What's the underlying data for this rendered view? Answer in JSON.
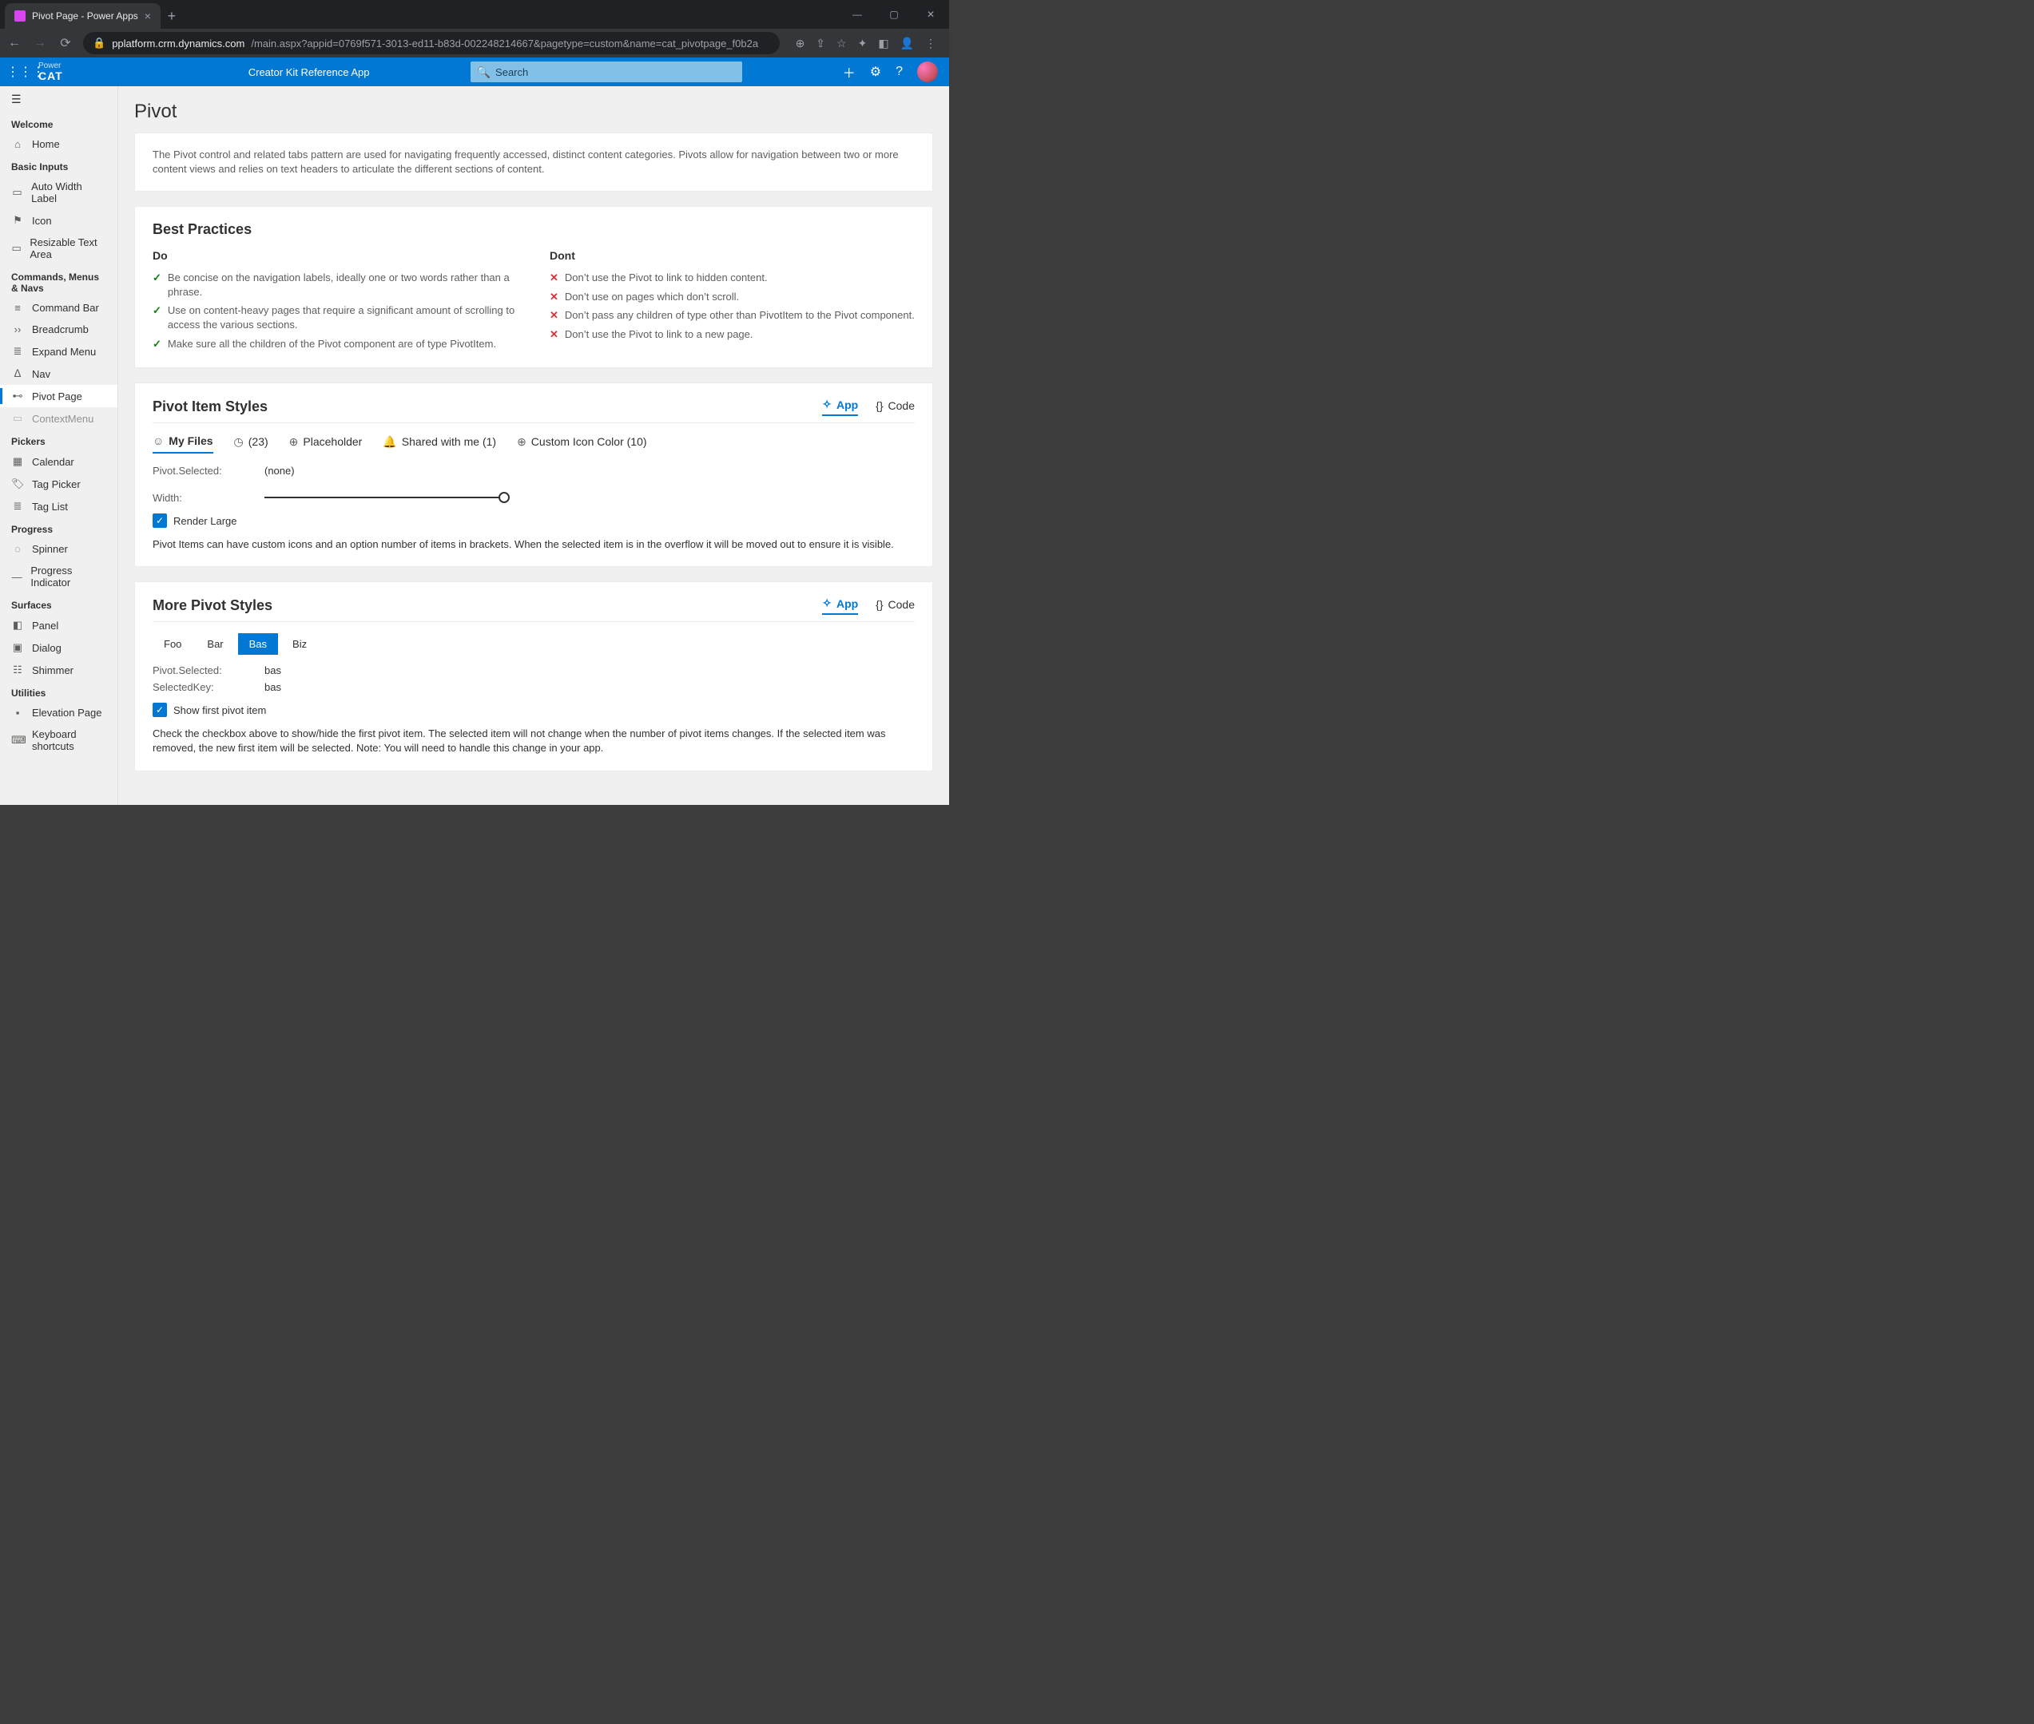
{
  "browser": {
    "tab_title": "Pivot Page - Power Apps",
    "url_domain": "pplatform.crm.dynamics.com",
    "url_path": "/main.aspx?appid=0769f571-3013-ed11-b83d-002248214667&pagetype=custom&name=cat_pivotpage_f0b2a"
  },
  "header": {
    "brand_top": "Power",
    "brand_bottom": "CAT",
    "app_title": "Creator Kit Reference App",
    "search_placeholder": "Search"
  },
  "sidebar": {
    "welcome": {
      "title": "Welcome",
      "home": "Home"
    },
    "basic_inputs": {
      "title": "Basic Inputs",
      "items": [
        "Auto Width Label",
        "Icon",
        "Resizable Text Area"
      ]
    },
    "cmn": {
      "title": "Commands, Menus & Navs",
      "items": [
        "Command Bar",
        "Breadcrumb",
        "Expand Menu",
        "Nav",
        "Pivot Page",
        "ContextMenu"
      ],
      "active": "Pivot Page"
    },
    "pickers": {
      "title": "Pickers",
      "items": [
        "Calendar",
        "Tag Picker",
        "Tag List"
      ]
    },
    "progress": {
      "title": "Progress",
      "items": [
        "Spinner",
        "Progress Indicator"
      ]
    },
    "surfaces": {
      "title": "Surfaces",
      "items": [
        "Panel",
        "Dialog",
        "Shimmer"
      ]
    },
    "utilities": {
      "title": "Utilities",
      "items": [
        "Elevation Page",
        "Keyboard shortcuts"
      ]
    }
  },
  "page": {
    "title": "Pivot",
    "intro": "The Pivot control and related tabs pattern are used for navigating frequently accessed, distinct content categories. Pivots allow for navigation between two or more content views and relies on text headers to articulate the different sections of content.",
    "bp_title": "Best Practices",
    "do_title": "Do",
    "dont_title": "Dont",
    "do_items": [
      "Be concise on the navigation labels, ideally one or two words rather than a phrase.",
      "Use on content-heavy pages that require a significant amount of scrolling to access the various sections.",
      "Make sure all the children of the Pivot component are of type PivotItem."
    ],
    "dont_items": [
      "Don’t use the Pivot to link to hidden content.",
      "Don’t use on pages which don’t scroll.",
      "Don’t pass any children of type other than PivotItem to the Pivot component.",
      "Don’t use the Pivot to link to a new page."
    ],
    "appcode": {
      "app": "App",
      "code": "Code"
    },
    "section1": {
      "title": "Pivot Item Styles",
      "pivots": [
        {
          "icon": "☺",
          "label": "My Files",
          "active": true
        },
        {
          "icon": "◷",
          "label": "(23)"
        },
        {
          "icon": "⊕",
          "label": "Placeholder"
        },
        {
          "icon": "🔔",
          "label": "Shared with me (1)"
        },
        {
          "icon": "⊕",
          "label": "Custom Icon Color (10)"
        }
      ],
      "selected_label": "Pivot.Selected:",
      "selected_value": "(none)",
      "width_label": "Width:",
      "render_large_label": "Render Large",
      "note": "Pivot Items can have custom icons and an option number of items in brackets. When the selected item is in the overflow it will be moved out to ensure it is visible."
    },
    "section2": {
      "title": "More Pivot Styles",
      "pivots": [
        "Foo",
        "Bar",
        "Bas",
        "Biz"
      ],
      "selected_pivot": "Bas",
      "sel_label": "Pivot.Selected:",
      "sel_value": "bas",
      "key_label": "SelectedKey:",
      "key_value": "bas",
      "show_first_label": "Show first pivot item",
      "note": "Check the checkbox above to show/hide the first pivot item. The selected item will not change when the number of pivot items changes. If the selected item was removed, the new first item will be selected. Note: You will need to handle this change in your app."
    }
  }
}
